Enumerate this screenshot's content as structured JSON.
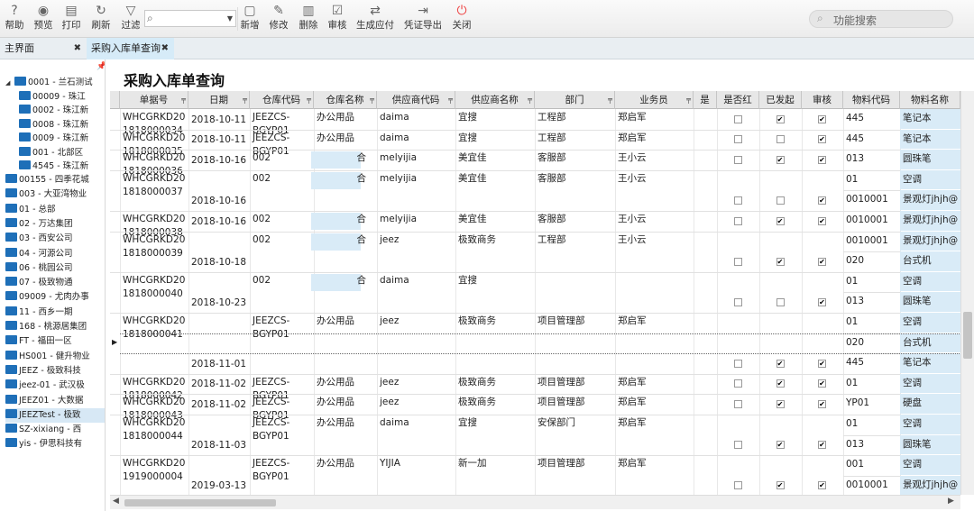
{
  "toolbar": {
    "buttons": [
      {
        "name": "help",
        "label": "帮助",
        "icon": "help-icon"
      },
      {
        "name": "preview",
        "label": "预览",
        "icon": "eye-icon"
      },
      {
        "name": "print",
        "label": "打印",
        "icon": "printer-icon"
      },
      {
        "name": "refresh",
        "label": "刷新",
        "icon": "refresh-icon"
      },
      {
        "name": "filter",
        "label": "过滤",
        "icon": "filter-icon"
      },
      {
        "name": "add",
        "label": "新增",
        "icon": "new-doc-icon"
      },
      {
        "name": "edit",
        "label": "修改",
        "icon": "edit-icon"
      },
      {
        "name": "delete",
        "label": "删除",
        "icon": "trash-icon"
      },
      {
        "name": "audit",
        "label": "审核",
        "icon": "audit-icon"
      },
      {
        "name": "gen-payable",
        "label": "生成应付",
        "icon": "exchange-icon"
      },
      {
        "name": "export-voucher",
        "label": "凭证导出",
        "icon": "export-icon"
      },
      {
        "name": "close",
        "label": "关闭",
        "icon": "power-icon"
      }
    ],
    "search_select_value": "",
    "function_search_placeholder": "功能搜索"
  },
  "tabs": [
    {
      "label": "主界面",
      "active": false
    },
    {
      "label": "采购入库单查询",
      "active": true
    }
  ],
  "tree": [
    {
      "label": "0001 - 兰石测试",
      "level": 0,
      "expanded": true
    },
    {
      "label": "00009 - 珠江",
      "level": 1
    },
    {
      "label": "0002 - 珠江新",
      "level": 1
    },
    {
      "label": "0008 - 珠江新",
      "level": 1
    },
    {
      "label": "0009 - 珠江新",
      "level": 1
    },
    {
      "label": "001 - 北部区",
      "level": 1
    },
    {
      "label": "4545 - 珠江新",
      "level": 1
    },
    {
      "label": "00155 - 四季花城",
      "level": 0
    },
    {
      "label": "003 - 大亚湾物业",
      "level": 0
    },
    {
      "label": "01 - 总部",
      "level": 0
    },
    {
      "label": "02 - 万达集团",
      "level": 0
    },
    {
      "label": "03 - 西安公司",
      "level": 0
    },
    {
      "label": "04 - 河源公司",
      "level": 0
    },
    {
      "label": "06 - 桃园公司",
      "level": 0
    },
    {
      "label": "07 - 极致物通",
      "level": 0
    },
    {
      "label": "09009 - 尤肉办事",
      "level": 0
    },
    {
      "label": "11 - 西乡一期",
      "level": 0
    },
    {
      "label": "168 - 桃源居集团",
      "level": 0
    },
    {
      "label": "FT - 福田一区",
      "level": 0
    },
    {
      "label": "HS001 - 健升物业",
      "level": 0
    },
    {
      "label": "JEEZ - 极致科技",
      "level": 0
    },
    {
      "label": "jeez-01 - 武汉极",
      "level": 0
    },
    {
      "label": "JEEZ01 - 大数据",
      "level": 0
    },
    {
      "label": "JEEZTest - 极致",
      "level": 0,
      "selected": true
    },
    {
      "label": "SZ-xixiang - 西",
      "level": 0
    },
    {
      "label": "yis - 伊思科技有",
      "level": 0
    }
  ],
  "page_title": "采购入库单查询",
  "columns": [
    "单据号",
    "日期",
    "仓库代码",
    "仓库名称",
    "供应商代码",
    "供应商名称",
    "部门",
    "业务员",
    "是",
    "是否红",
    "已发起",
    "审核",
    "物料代码",
    "物料名称"
  ],
  "rows": [
    {
      "lines": 1,
      "no": [
        "WHCGRKD20",
        "1818000034"
      ],
      "date": "2018-10-11",
      "wh_code": [
        "JEEZCS-",
        "BGYP01"
      ],
      "wh_name": "办公用品",
      "sup_code": "daima",
      "sup_name": "宜搜",
      "dept": "工程部",
      "clerk": "郑启军",
      "red": false,
      "sent": true,
      "audit": true,
      "items": [
        {
          "code": "445",
          "name": "笔记本"
        }
      ]
    },
    {
      "lines": 1,
      "no": [
        "WHCGRKD20",
        "1818000035"
      ],
      "date": "2018-10-11",
      "wh_code": [
        "JEEZCS-",
        "BGYP01"
      ],
      "wh_name": "办公用品",
      "sup_code": "daima",
      "sup_name": "宜搜",
      "dept": "工程部",
      "clerk": "郑启军",
      "red": false,
      "sent": false,
      "audit": true,
      "items": [
        {
          "code": "445",
          "name": "笔记本"
        }
      ]
    },
    {
      "lines": 1,
      "no": [
        "WHCGRKD20",
        "1818000036"
      ],
      "date": "2018-10-16",
      "wh_code": [
        "002"
      ],
      "wh_name": "合",
      "masked": true,
      "sup_code": "melyijia",
      "sup_name": "美宜佳",
      "dept": "客服部",
      "clerk": "王小云",
      "red": false,
      "sent": true,
      "audit": true,
      "items": [
        {
          "code": "013",
          "name": "圆珠笔"
        }
      ]
    },
    {
      "lines": 2,
      "no": [
        "WHCGRKD20",
        "1818000037"
      ],
      "date": "2018-10-16",
      "wh_code": [
        "002"
      ],
      "wh_name": "合",
      "masked": true,
      "sup_code": "melyijia",
      "sup_name": "美宜佳",
      "dept": "客服部",
      "clerk": "王小云",
      "red": false,
      "sent": false,
      "audit": true,
      "items": [
        {
          "code": "01",
          "name": "空调"
        },
        {
          "code": "0010001",
          "name": "景观灯jhjh@"
        }
      ]
    },
    {
      "lines": 1,
      "no": [
        "WHCGRKD20",
        "1818000038"
      ],
      "date": "2018-10-16",
      "wh_code": [
        "002"
      ],
      "wh_name": "合",
      "masked": true,
      "sup_code": "melyijia",
      "sup_name": "美宜佳",
      "dept": "客服部",
      "clerk": "王小云",
      "red": false,
      "sent": true,
      "audit": true,
      "items": [
        {
          "code": "0010001",
          "name": "景观灯jhjh@"
        }
      ]
    },
    {
      "lines": 2,
      "no": [
        "WHCGRKD20",
        "1818000039"
      ],
      "date": "2018-10-18",
      "wh_code": [
        "002"
      ],
      "wh_name": "合",
      "masked": true,
      "sup_code": "jeez",
      "sup_name": "极致商务",
      "dept": "工程部",
      "clerk": "王小云",
      "red": false,
      "sent": true,
      "audit": true,
      "items": [
        {
          "code": "0010001",
          "name": "景观灯jhjh@"
        },
        {
          "code": "020",
          "name": "台式机"
        }
      ]
    },
    {
      "lines": 2,
      "no": [
        "WHCGRKD20",
        "1818000040"
      ],
      "date": "2018-10-23",
      "wh_code": [
        "002"
      ],
      "wh_name": "合",
      "masked": true,
      "sup_code": "daima",
      "sup_name": "宜搜",
      "dept": "",
      "clerk": "",
      "red": false,
      "sent": false,
      "audit": true,
      "items": [
        {
          "code": "01",
          "name": "空调"
        },
        {
          "code": "013",
          "name": "圆珠笔"
        }
      ]
    },
    {
      "lines": 3,
      "current": true,
      "no": [
        "WHCGRKD20",
        "1818000041"
      ],
      "date": "2018-11-01",
      "wh_code": [
        "JEEZCS-",
        "BGYP01"
      ],
      "wh_name": "办公用品",
      "sup_code": "jeez",
      "sup_name": "极致商务",
      "dept": "项目管理部",
      "clerk": "郑启军",
      "red": false,
      "sent": true,
      "audit": true,
      "items": [
        {
          "code": "01",
          "name": "空调"
        },
        {
          "code": "020",
          "name": "台式机"
        },
        {
          "code": "445",
          "name": "笔记本"
        }
      ]
    },
    {
      "lines": 1,
      "no": [
        "WHCGRKD20",
        "1818000042"
      ],
      "date": "2018-11-02",
      "wh_code": [
        "JEEZCS-",
        "BGYP01"
      ],
      "wh_name": "办公用品",
      "sup_code": "jeez",
      "sup_name": "极致商务",
      "dept": "项目管理部",
      "clerk": "郑启军",
      "red": false,
      "sent": true,
      "audit": true,
      "items": [
        {
          "code": "01",
          "name": "空调"
        }
      ]
    },
    {
      "lines": 1,
      "no": [
        "WHCGRKD20",
        "1818000043"
      ],
      "date": "2018-11-02",
      "wh_code": [
        "JEEZCS-",
        "BGYP01"
      ],
      "wh_name": "办公用品",
      "sup_code": "jeez",
      "sup_name": "极致商务",
      "dept": "项目管理部",
      "clerk": "郑启军",
      "red": false,
      "sent": true,
      "audit": true,
      "items": [
        {
          "code": "YP01",
          "name": "硬盘"
        }
      ]
    },
    {
      "lines": 2,
      "no": [
        "WHCGRKD20",
        "1818000044"
      ],
      "date": "2018-11-03",
      "wh_code": [
        "JEEZCS-",
        "BGYP01"
      ],
      "wh_name": "办公用品",
      "sup_code": "daima",
      "sup_name": "宜搜",
      "dept": "安保部门",
      "clerk": "郑启军",
      "red": false,
      "sent": true,
      "audit": true,
      "items": [
        {
          "code": "01",
          "name": "空调"
        },
        {
          "code": "013",
          "name": "圆珠笔"
        }
      ]
    },
    {
      "lines": 2,
      "no": [
        "WHCGRKD20",
        "1919000004"
      ],
      "date": "2019-03-13",
      "wh_code": [
        "JEEZCS-",
        "BGYP01"
      ],
      "wh_name": "办公用品",
      "sup_code": "YIJIA",
      "sup_name": "新一加",
      "dept": "项目管理部",
      "clerk": "郑启军",
      "red": false,
      "sent": true,
      "audit": true,
      "items": [
        {
          "code": "001",
          "name": "空调"
        },
        {
          "code": "0010001",
          "name": "景观灯jhjh@"
        }
      ]
    }
  ],
  "colors": {
    "accent": "#1e6fb8",
    "highlight": "#d9ebf7",
    "header": "#e7e7e7"
  }
}
